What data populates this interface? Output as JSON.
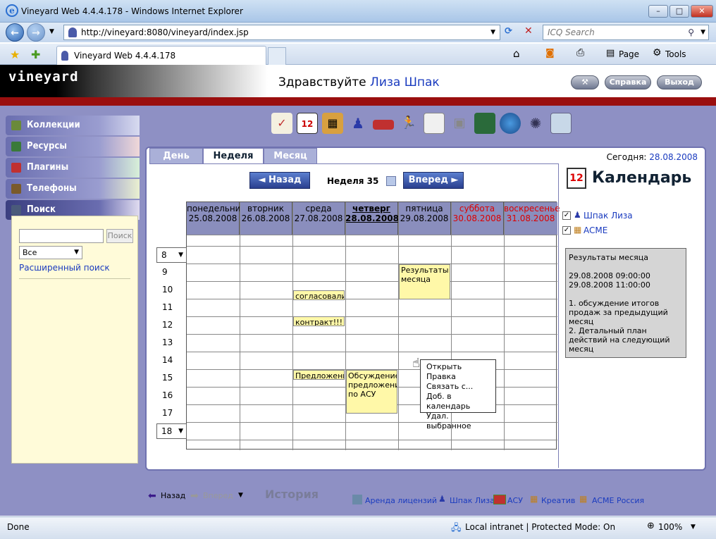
{
  "window": {
    "title": "Vineyard Web 4.4.4.178 - Windows Internet Explorer",
    "minimize": "–",
    "maximize": "□",
    "close": "✕"
  },
  "address": {
    "url": "http://vineyard:8080/vineyard/index.jsp",
    "search_placeholder": "ICQ Search"
  },
  "tabbar": {
    "tab_label": "Vineyard Web 4.4.4.178",
    "page_menu": "Page",
    "tools_menu": "Tools"
  },
  "header": {
    "logo": "vineyard",
    "greeting": "Здравствуйте",
    "user": "Лиза Шпак",
    "btn_help": "Справка",
    "btn_exit": "Выход"
  },
  "sidebar": {
    "items": [
      {
        "label": "Коллекции",
        "color": "#6a8a3a"
      },
      {
        "label": "Ресурсы",
        "color": "#3a7a3a"
      },
      {
        "label": "Плагины",
        "color": "#c03030"
      },
      {
        "label": "Телефоны",
        "color": "#7a5a2a"
      },
      {
        "label": "Поиск",
        "color": "#4a5a7a"
      }
    ],
    "search": {
      "button": "Поиск",
      "select_value": "Все",
      "advanced": "Расширенный поиск"
    }
  },
  "toolbar_icons": [
    "todo-icon",
    "calendar-icon",
    "building-icon",
    "person-icon",
    "book-icon",
    "run-icon",
    "document-icon",
    "boxes-icon",
    "notebook-icon",
    "globe-icon",
    "compass-icon",
    "network-icon"
  ],
  "calendar": {
    "tabs": [
      "День",
      "Неделя",
      "Месяц"
    ],
    "today_label": "Сегодня:",
    "today_date": "28.08.2008",
    "prev": "◄ Назад",
    "next": "Вперед ►",
    "week_label": "Неделя 35",
    "days": [
      {
        "name": "понедельник",
        "date": "25.08.2008"
      },
      {
        "name": "вторник",
        "date": "26.08.2008"
      },
      {
        "name": "среда",
        "date": "27.08.2008"
      },
      {
        "name": "четверг",
        "date": "28.08.2008"
      },
      {
        "name": "пятница",
        "date": "29.08.2008"
      },
      {
        "name": "суббота",
        "date": "30.08.2008"
      },
      {
        "name": "воскресенье",
        "date": "31.08.2008"
      }
    ],
    "start_hour": "8",
    "end_hour": "18",
    "hours": [
      "9",
      "10",
      "11",
      "12",
      "13",
      "14",
      "15",
      "16",
      "17"
    ],
    "events": [
      {
        "text": "Результаты месяца"
      },
      {
        "text": "согласовали"
      },
      {
        "text": "контракт!!!"
      },
      {
        "text": "Предложени"
      },
      {
        "text": "Обсуждение предложени по АСУ"
      }
    ],
    "context_menu": [
      "Открыть",
      "Правка",
      "Связать с...",
      "Доб. в календарь",
      "Удал. выбранное"
    ]
  },
  "right": {
    "title": "Календарь",
    "calendars": [
      "Шпак Лиза",
      "ACME"
    ],
    "detail": "Результаты месяца\n\n29.08.2008 09:00:00\n29.08.2008 11:00:00\n\n1. обсуждение итогов продаж за предыдущий месяц\n2. Детальный план действий на следующий месяц"
  },
  "bottom": {
    "back": "Назад",
    "forward": "Вперед",
    "history": "История",
    "links": [
      "Аренда лицензий",
      "Шпак Лиза",
      "АСУ",
      "Креатив",
      "ACME Россия"
    ]
  },
  "status": {
    "left": "Done",
    "zone": "Local intranet | Protected Mode: On",
    "zoom": "100%"
  }
}
